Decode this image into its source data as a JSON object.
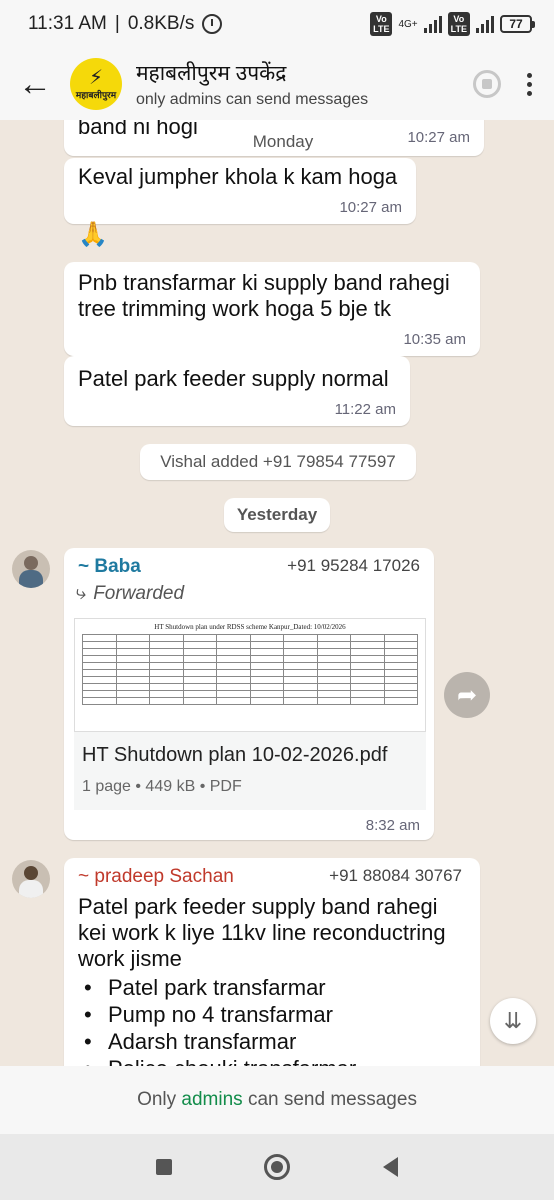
{
  "status_bar": {
    "time": "11:31 AM",
    "speed": "0.8KB/s",
    "volte1": "Vo\nLTE",
    "net": "4G+",
    "volte2": "Vo\nLTE",
    "battery": "77"
  },
  "header": {
    "group_name": "महाबलीपुरम उपकेंद्र",
    "subtitle": "only admins can send messages",
    "avatar_text": "महाबलीपुरम"
  },
  "chat": {
    "partial_message": "band ni hogi",
    "partial_time": "10:27 am",
    "day_label_1": "Monday",
    "messages": [
      {
        "text": "Keval jumpher khola k kam hoga",
        "time": "10:27 am"
      },
      {
        "text": "Pnb transfarmar ki supply band rahegi tree trimming work hoga 5 bje tk",
        "time": "10:35 am"
      },
      {
        "text": "Patel park feeder supply normal",
        "time": "11:22 am"
      }
    ],
    "reaction": "🙏",
    "system_msg": "Vishal added +91 79854 77597",
    "day_label_2": "Yesterday",
    "doc_msg": {
      "sender": "~ Baba",
      "phone": "+91 95284 17026",
      "forwarded": "Forwarded",
      "doc_preview_title": "HT Shutdown plan under RDSS scheme Kanpur_Dated: 10/02/2026",
      "file_name": "HT Shutdown plan 10-02-2026.pdf",
      "file_meta": "1 page • 449 kB • PDF",
      "time": "8:32 am"
    },
    "last_msg": {
      "sender": "~ pradeep Sachan",
      "phone": "+91 88084 30767",
      "text": "Patel park feeder supply band rahegi kei work k liye 11kv line reconductring work jisme",
      "bullets": [
        "Patel park transfarmar",
        "Pump no 4 transfarmar",
        "Adarsh transfarmar",
        "Police chouki transfarmar"
      ]
    }
  },
  "footer": {
    "pre": "Only ",
    "link": "admins",
    "post": " can send messages"
  },
  "icons": {
    "back": "arrow-left-icon",
    "call": "group-call-icon",
    "menu": "more-vert-icon",
    "share": "forward-share-icon",
    "scroll": "chevron-double-down-icon"
  }
}
